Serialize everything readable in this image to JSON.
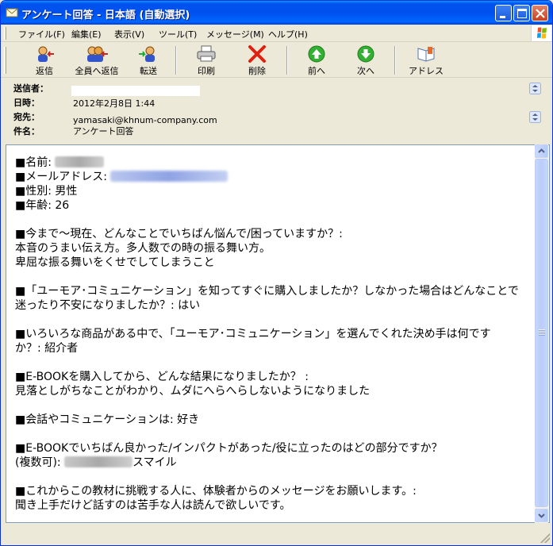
{
  "window": {
    "title": "アンケート回答 - 日本語 (自動選択)"
  },
  "menu": {
    "items": [
      "ファイル(F)",
      "編集(E)",
      "表示(V)",
      "ツール(T)",
      "メッセージ(M)",
      "ヘルプ(H)"
    ]
  },
  "toolbar": {
    "reply": "返信",
    "reply_all": "全員へ返信",
    "forward": "転送",
    "print": "印刷",
    "delete": "削除",
    "previous": "前へ",
    "next": "次へ",
    "address": "アドレス"
  },
  "header": {
    "from_label": "送信者：",
    "date_label": "日時：",
    "date_value": "2012年2月8日 1:44",
    "to_label": "宛先：",
    "to_value": "yamasaki@khnum-company.com",
    "subject_label": "件名：",
    "subject_value": "アンケート回答"
  },
  "body": {
    "name_label": "■名前:",
    "email_label": "■メールアドレス:",
    "gender": "■性別: 男性",
    "age": "■年齢: 26",
    "q1": "■今まで～現在、どんなことでいちばん悩んで/困っていますか？:",
    "a1_line1": "本音のうまい伝え方。多人数での時の振る舞い方。",
    "a1_line2": "卑屈な振る舞いをくせでしてしまうこと",
    "q2_line1": "■「ユーモア･コミュニケーション」を知ってすぐに購入しましたか？しなかった場合はどんなことで",
    "q2_line2": "迷ったり不安になりましたか？: はい",
    "q3_line1": "■いろいろな商品がある中で、「ユーモア･コミュニケーション」を選んでくれた決め手は何です",
    "q3_line2": "か？: 紹介者",
    "q4": "■E-BOOKを購入してから、どんな結果になりましたか？ :",
    "a4": "見落としがちなことがわかり、ムダにへらへらしないようになりました",
    "q5": "■会話やコミュニケーションは: 好き",
    "q6_line1": "■E-BOOKでいちばん良かった/インパクトがあった/役に立ったのはどの部分ですか？",
    "q6_line2_prefix": "(複数可):",
    "q6_line2_suffix": "スマイル",
    "q7": "■これからこの教材に挑戦する人に、体験者からのメッセージをお願いします。:",
    "a7": "聞き上手だけど話すのは苦手な人は読んで欲しいです。"
  }
}
